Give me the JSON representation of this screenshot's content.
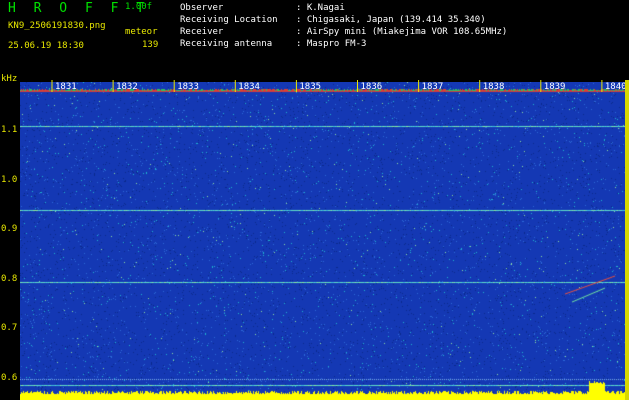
{
  "header": {
    "app_title": "H R O F F T",
    "version": "1.00f",
    "filename": "KN9_2506191830.png",
    "datetime": "25.06.19 18:30",
    "meteor_label": "meteor",
    "meteor_count": "139",
    "info": [
      {
        "label": "Observer",
        "value": ": K.Nagai"
      },
      {
        "label": "Receiving Location",
        "value": ": Chigasaki, Japan (139.414 35.340)"
      },
      {
        "label": "Receiver",
        "value": ": AirSpy mini (Miakejima VOR 108.65MHz)"
      },
      {
        "label": "Receiving antenna",
        "value": ": Maspro FM-3"
      }
    ]
  },
  "axis": {
    "unit": "kHz",
    "y_ticks": [
      "1.1",
      "1.0",
      "0.9",
      "0.8",
      "0.7",
      "0.6"
    ],
    "time_labels": [
      "1831",
      "1832",
      "1833",
      "1834",
      "1835",
      "1836",
      "1837",
      "1838",
      "1839",
      "1840"
    ]
  },
  "colors": {
    "background": "#1438b4",
    "label_text": "#e8e800",
    "title_green": "#00e000",
    "bottom_bar": "#ffff00"
  },
  "chart_data": {
    "type": "heatmap",
    "ylim": [
      0.58,
      1.2
    ],
    "x_range_minutes": [
      "1831",
      "1840"
    ],
    "horizontal_lines_khz": [
      1.115,
      0.95,
      0.81,
      0.61
    ]
  }
}
